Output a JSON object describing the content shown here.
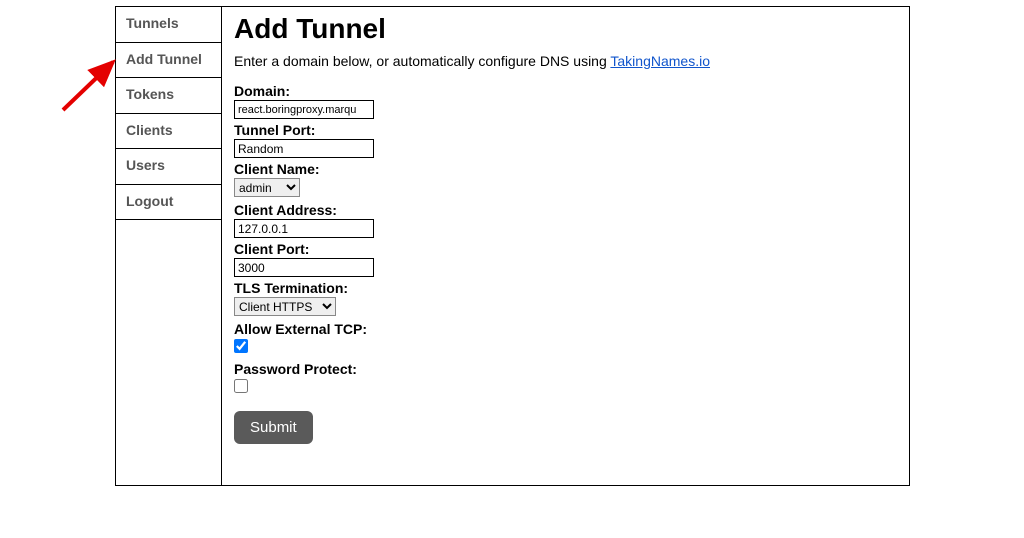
{
  "sidebar": {
    "items": [
      {
        "label": "Tunnels"
      },
      {
        "label": "Add Tunnel"
      },
      {
        "label": "Tokens"
      },
      {
        "label": "Clients"
      },
      {
        "label": "Users"
      },
      {
        "label": "Logout"
      }
    ]
  },
  "page": {
    "title": "Add Tunnel",
    "intro_prefix": "Enter a domain below, or automatically configure DNS using ",
    "intro_link_text": "TakingNames.io"
  },
  "form": {
    "domain_label": "Domain:",
    "domain_value": "react.boringproxy.marqu",
    "tunnel_port_label": "Tunnel Port:",
    "tunnel_port_value": "Random",
    "client_name_label": "Client Name:",
    "client_name_value": "admin",
    "client_address_label": "Client Address:",
    "client_address_value": "127.0.0.1",
    "client_port_label": "Client Port:",
    "client_port_value": "3000",
    "tls_termination_label": "TLS Termination:",
    "tls_termination_value": "Client HTTPS",
    "allow_external_tcp_label": "Allow External TCP:",
    "allow_external_tcp_checked": true,
    "password_protect_label": "Password Protect:",
    "password_protect_checked": false,
    "submit_label": "Submit"
  }
}
